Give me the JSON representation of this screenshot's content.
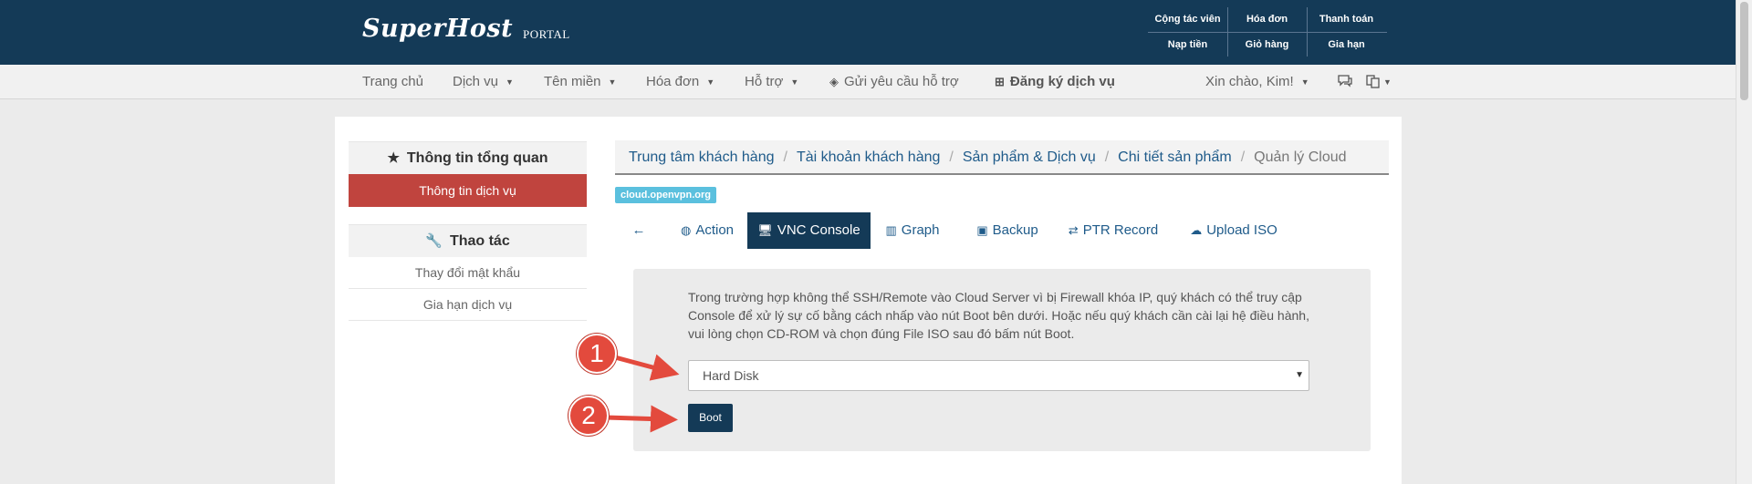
{
  "brand": {
    "name": "SuperHost",
    "sub": "PORTAL"
  },
  "quick_links": {
    "row1": [
      "Cộng tác viên",
      "Hóa đơn",
      "Thanh toán"
    ],
    "row2": [
      "Nạp tiền",
      "Giỏ hàng",
      "Gia hạn"
    ]
  },
  "nav": {
    "home": "Trang chủ",
    "services": "Dịch vụ",
    "domains": "Tên miền",
    "invoices": "Hóa đơn",
    "support": "Hỗ trợ",
    "ticket": "Gửi yêu cầu hỗ trợ",
    "register": "Đăng ký dịch vụ",
    "greeting": "Xin chào, Kim!"
  },
  "sidebar": {
    "overview_title": "Thông tin tổng quan",
    "overview_items": [
      "Thông tin dịch vụ"
    ],
    "actions_title": "Thao tác",
    "action_items": [
      "Thay đổi mật khẩu",
      "Gia hạn dịch vụ"
    ]
  },
  "breadcrumb": [
    "Trung tâm khách hàng",
    "Tài khoản khách hàng",
    "Sản phẩm & Dịch vụ",
    "Chi tiết sản phẩm",
    "Quản lý Cloud"
  ],
  "host_tag": "cloud.openvpn.org",
  "tabs": {
    "back": "←",
    "action": "Action",
    "vnc": "VNC Console",
    "graph": "Graph",
    "backup": "Backup",
    "ptr": "PTR Record",
    "upload": "Upload ISO"
  },
  "console": {
    "description": "Trong trường hợp không thể SSH/Remote vào Cloud Server vì bị Firewall khóa IP, quý khách có thể truy cập Console để xử lý sự cố bằng cách nhấp vào nút Boot bên dưới. Hoặc nếu quý khách cần cài lại hệ điều hành, vui lòng chọn CD-ROM và chọn đúng File ISO sau đó bấm nút Boot.",
    "boot_device": "Hard Disk",
    "boot_label": "Boot"
  },
  "annotations": [
    "1",
    "2"
  ],
  "icons": {
    "overview": "star-icon",
    "actions": "wrench-icon",
    "ticket": "tag-icon",
    "register": "plus-square-icon",
    "chat": "chat-icon",
    "language": "language-icon",
    "action_tab": "globe-icon",
    "vnc_tab": "desktop-icon",
    "graph_tab": "bar-chart-icon",
    "backup_tab": "save-icon",
    "ptr_tab": "exchange-icon",
    "upload_tab": "cloud-upload-icon"
  },
  "colors": {
    "primary": "#143a57",
    "active_sidebar": "#c0443e",
    "tag": "#5bc0de",
    "annotation": "#e34a3d"
  }
}
